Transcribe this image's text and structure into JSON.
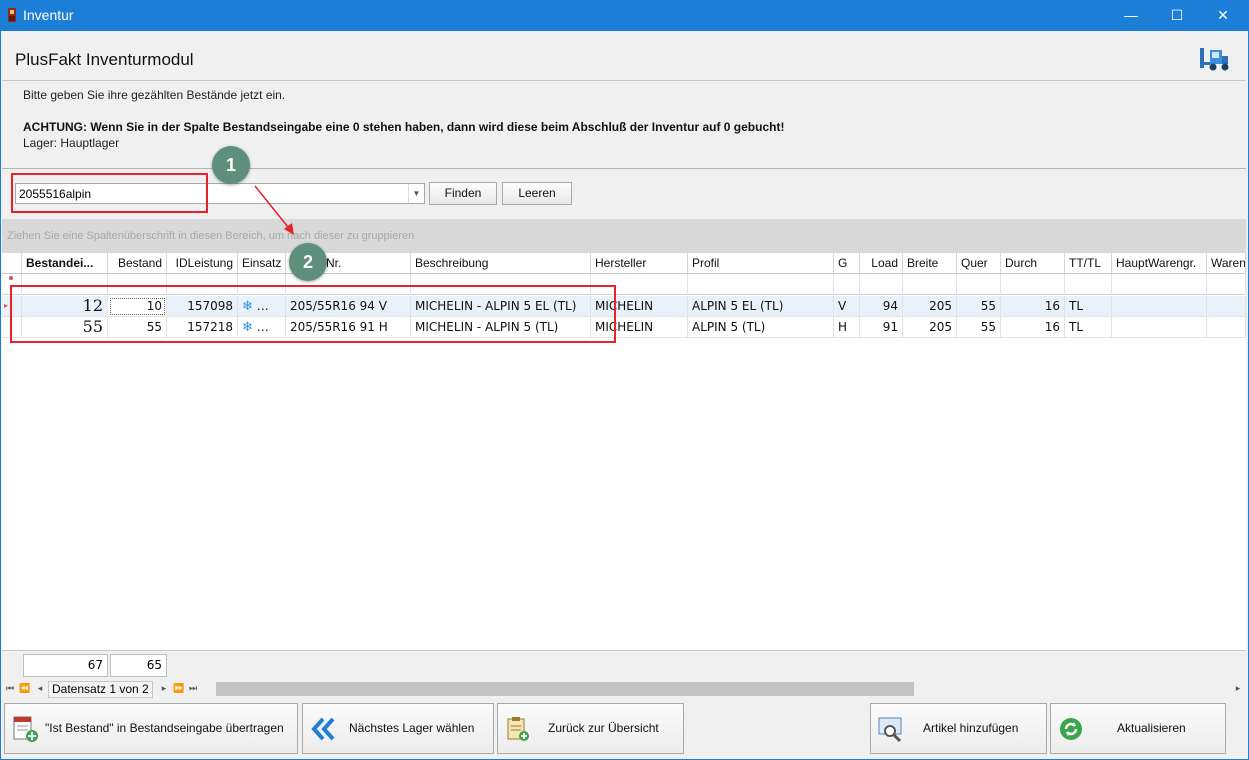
{
  "window": {
    "title": "Inventur",
    "minimize_glyph": "—",
    "maximize_glyph": "☐",
    "close_glyph": "✕"
  },
  "header": {
    "title": "PlusFakt Inventurmodul",
    "icon": "forklift-icon"
  },
  "info": {
    "line1": "Bitte geben Sie ihre gezählten Bestände jetzt ein.",
    "warning": "ACHTUNG: Wenn Sie in der Spalte Bestandseingabe eine 0 stehen haben, dann wird diese beim Abschluß der Inventur auf 0 gebucht!",
    "lager": "Lager: Hauptlager"
  },
  "search": {
    "value": "2055516alpin",
    "find_label": "Finden",
    "clear_label": "Leeren"
  },
  "group_panel": {
    "hint": "Ziehen Sie eine Spaltenüberschrift in diesen Bereich, um nach dieser zu gruppieren"
  },
  "grid": {
    "columns": [
      "Bestandei...",
      "Bestand",
      "IDLeistung",
      "Einsatz",
      "Nr.",
      "Beschreibung",
      "Hersteller",
      "Profil",
      "G",
      "Load",
      "Breite",
      "Quer",
      "Durch",
      "TT/TL",
      "HauptWarengr.",
      "Waren"
    ],
    "rows": [
      {
        "eingabe": "12",
        "bestand": "10",
        "id": "157098",
        "einsatz": "…",
        "nr": "205/55R16 94 V",
        "beschreibung": "MICHELIN - ALPIN 5 EL (TL)",
        "hersteller": "MICHELIN",
        "profil": "ALPIN 5 EL (TL)",
        "g": "V",
        "load": "94",
        "breite": "205",
        "quer": "55",
        "durch": "16",
        "tttl": "TL"
      },
      {
        "eingabe": "55",
        "bestand": "55",
        "id": "157218",
        "einsatz": "…",
        "nr": "205/55R16 91 H",
        "beschreibung": "MICHELIN - ALPIN 5 (TL)",
        "hersteller": "MICHELIN",
        "profil": "ALPIN 5 (TL)",
        "g": "H",
        "load": "91",
        "breite": "205",
        "quer": "55",
        "durch": "16",
        "tttl": "TL"
      }
    ],
    "totals": {
      "eingabe": "67",
      "bestand": "65"
    }
  },
  "navigator": {
    "first": "⏮",
    "prev_page": "⏪",
    "prev": "◂",
    "record_text": "Datensatz 1 von 2",
    "next": "▸",
    "next_page": "⏩",
    "last": "⏭"
  },
  "buttons": {
    "transfer": "\"Ist Bestand\" in Bestandseingabe übertragen",
    "next_lager": "Nächstes Lager wählen",
    "back": "Zurück zur Übersicht",
    "add_article": "Artikel hinzufügen",
    "refresh": "Aktualisieren"
  },
  "annotations": {
    "badge1": "1",
    "badge2": "2"
  },
  "colors": {
    "titlebar": "#1c7ed6",
    "annotation_red": "#e6222a",
    "badge_green": "#5e8f7c"
  }
}
